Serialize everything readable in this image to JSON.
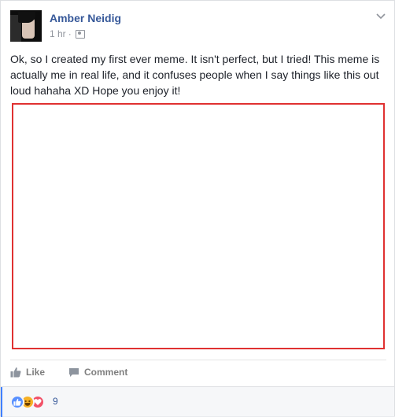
{
  "post": {
    "author": "Amber Neidig",
    "time": "1 hr",
    "separator": "·",
    "audience_icon": "friends-icon",
    "menu_icon": "chevron-down-icon",
    "text": "Ok, so I created my first ever meme. It isn't perfect, but I tried! This meme is actually me in real life, and it confuses people when I say things like this out loud hahaha XD Hope you enjoy it!"
  },
  "image": {
    "border_color": "#e03131"
  },
  "actions": {
    "like_label": "Like",
    "comment_label": "Comment"
  },
  "reactions": {
    "icons": [
      "like-reaction-icon",
      "haha-reaction-icon",
      "love-reaction-icon"
    ],
    "count": "9"
  },
  "colors": {
    "author_link": "#365899",
    "meta": "#90949c",
    "like": "#5890ff",
    "haha": "#f7b125",
    "love": "#f25268",
    "accent": "#4080ff"
  }
}
